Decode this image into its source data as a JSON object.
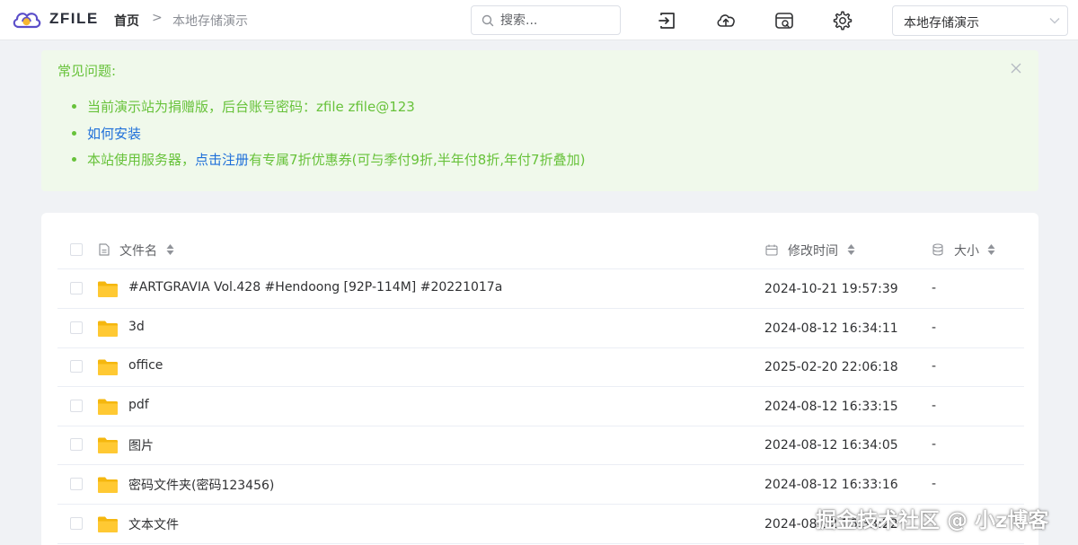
{
  "app": {
    "brand": "ZFILE"
  },
  "breadcrumb": {
    "home": "首页",
    "separator": ">",
    "current": "本地存储演示"
  },
  "search": {
    "placeholder": "搜索..."
  },
  "toolbar": {
    "icons": [
      "login-icon",
      "upload-cloud-icon",
      "storage-icon",
      "gear-icon"
    ]
  },
  "storage_select": {
    "selected": "本地存储演示"
  },
  "notice": {
    "title": "常见问题:",
    "item1": "当前演示站为捐赠版，后台账号密码：zfile zfile@123",
    "item2_link": "如何安装",
    "item3_prefix": "本站使用服务器，",
    "item3_link": "点击注册",
    "item3_suffix": "有专属7折优惠券(可与季付9折,半年付8折,年付7折叠加)"
  },
  "table": {
    "columns": {
      "name": "文件名",
      "time": "修改时间",
      "size": "大小"
    },
    "rows": [
      {
        "name": "#ARTGRAVIA Vol.428 #Hendoong [92P-114M] #20221017a",
        "time": "2024-10-21 19:57:39",
        "size": "-"
      },
      {
        "name": "3d",
        "time": "2024-08-12 16:34:11",
        "size": "-"
      },
      {
        "name": "office",
        "time": "2025-02-20 22:06:18",
        "size": "-"
      },
      {
        "name": "pdf",
        "time": "2024-08-12 16:33:15",
        "size": "-"
      },
      {
        "name": "图片",
        "time": "2024-08-12 16:34:05",
        "size": "-"
      },
      {
        "name": "密码文件夹(密码123456)",
        "time": "2024-08-12 16:33:16",
        "size": "-"
      },
      {
        "name": "文本文件",
        "time": "2024-08-12 16:33:22",
        "size": "-"
      }
    ]
  },
  "watermark": "掘金技术社区 @ 小z博客",
  "colors": {
    "accent": "#67c23a",
    "link": "#1e6fd9",
    "folder": "#ffc933",
    "background": "#f0f2f5"
  }
}
